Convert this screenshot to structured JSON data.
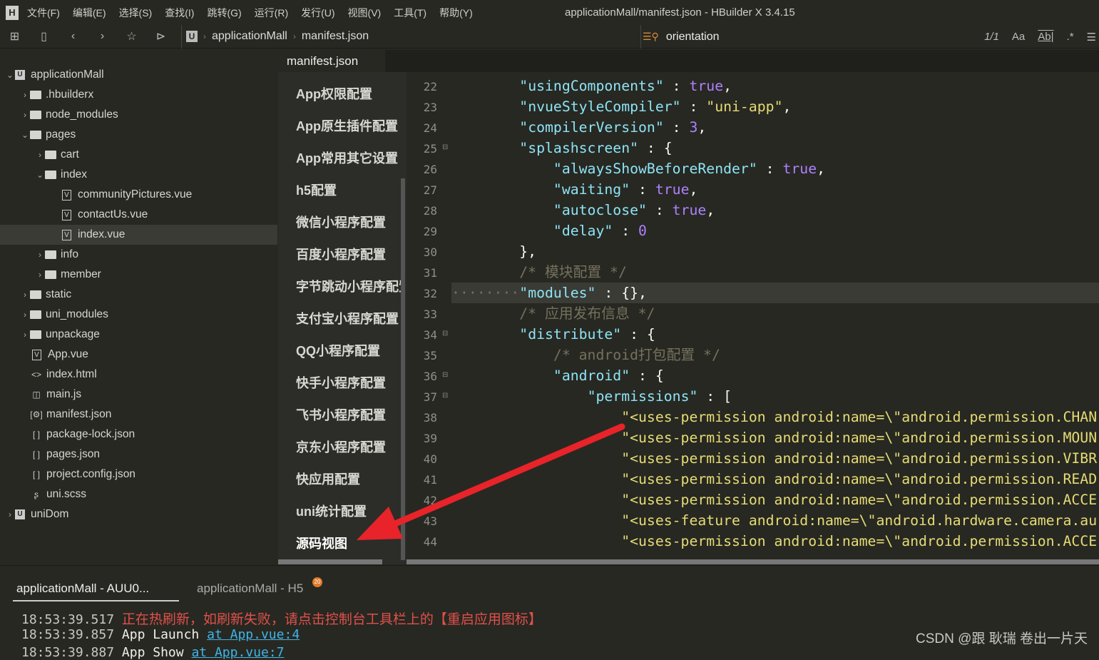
{
  "window": {
    "title": "applicationMall/manifest.json - HBuilder X 3.4.15",
    "logo": "H"
  },
  "menu": [
    "文件(F)",
    "编辑(E)",
    "选择(S)",
    "查找(I)",
    "跳转(G)",
    "运行(R)",
    "发行(U)",
    "视图(V)",
    "工具(T)",
    "帮助(Y)"
  ],
  "toolbar": {
    "icons": [
      "new-file-icon",
      "save-icon",
      "back-icon",
      "forward-icon",
      "star-icon",
      "run-icon"
    ],
    "breadcrumb": [
      "applicationMall",
      "manifest.json"
    ],
    "project_badge": "U"
  },
  "find": {
    "value": "orientation",
    "count": "1/1",
    "case": "Aa",
    "word": "Ab|",
    "regex": ".*"
  },
  "tree": [
    {
      "label": "applicationMall",
      "depth": 0,
      "type": "project",
      "open": true
    },
    {
      "label": ".hbuilderx",
      "depth": 1,
      "type": "folder",
      "open": false
    },
    {
      "label": "node_modules",
      "depth": 1,
      "type": "folder",
      "open": false
    },
    {
      "label": "pages",
      "depth": 1,
      "type": "folder",
      "open": true
    },
    {
      "label": "cart",
      "depth": 2,
      "type": "folder",
      "open": false
    },
    {
      "label": "index",
      "depth": 2,
      "type": "folder",
      "open": true
    },
    {
      "label": "communityPictures.vue",
      "depth": 3,
      "type": "vue"
    },
    {
      "label": "contactUs.vue",
      "depth": 3,
      "type": "vue"
    },
    {
      "label": "index.vue",
      "depth": 3,
      "type": "vue",
      "selected": true
    },
    {
      "label": "info",
      "depth": 2,
      "type": "folder",
      "open": false
    },
    {
      "label": "member",
      "depth": 2,
      "type": "folder",
      "open": false
    },
    {
      "label": "static",
      "depth": 1,
      "type": "folder",
      "open": false
    },
    {
      "label": "uni_modules",
      "depth": 1,
      "type": "folder",
      "open": false
    },
    {
      "label": "unpackage",
      "depth": 1,
      "type": "folder",
      "open": false
    },
    {
      "label": "App.vue",
      "depth": 1,
      "type": "vue"
    },
    {
      "label": "index.html",
      "depth": 1,
      "type": "html"
    },
    {
      "label": "main.js",
      "depth": 1,
      "type": "js"
    },
    {
      "label": "manifest.json",
      "depth": 1,
      "type": "manifest"
    },
    {
      "label": "package-lock.json",
      "depth": 1,
      "type": "json"
    },
    {
      "label": "pages.json",
      "depth": 1,
      "type": "json"
    },
    {
      "label": "project.config.json",
      "depth": 1,
      "type": "json"
    },
    {
      "label": "uni.scss",
      "depth": 1,
      "type": "scss"
    },
    {
      "label": "uniDom",
      "depth": 0,
      "type": "project",
      "open": false
    }
  ],
  "editor_tab": "manifest.json",
  "settings": [
    "App权限配置",
    "App原生插件配置",
    "App常用其它设置",
    "h5配置",
    "微信小程序配置",
    "百度小程序配置",
    "字节跳动小程序配置",
    "支付宝小程序配置",
    "QQ小程序配置",
    "快手小程序配置",
    "飞书小程序配置",
    "京东小程序配置",
    "快应用配置",
    "uni统计配置",
    "源码视图"
  ],
  "code": [
    {
      "n": "22",
      "t": [
        [
          "p",
          "        "
        ],
        [
          "key",
          "\"usingComponents\""
        ],
        [
          "p",
          " : "
        ],
        [
          "num",
          "true"
        ],
        [
          "p",
          ","
        ]
      ]
    },
    {
      "n": "23",
      "t": [
        [
          "p",
          "        "
        ],
        [
          "key",
          "\"nvueStyleCompiler\""
        ],
        [
          "p",
          " : "
        ],
        [
          "str",
          "\"uni-app\""
        ],
        [
          "p",
          ","
        ]
      ]
    },
    {
      "n": "24",
      "t": [
        [
          "p",
          "        "
        ],
        [
          "key",
          "\"compilerVersion\""
        ],
        [
          "p",
          " : "
        ],
        [
          "num",
          "3"
        ],
        [
          "p",
          ","
        ]
      ]
    },
    {
      "n": "25",
      "fold": true,
      "t": [
        [
          "p",
          "        "
        ],
        [
          "key",
          "\"splashscreen\""
        ],
        [
          "p",
          " : {"
        ]
      ]
    },
    {
      "n": "26",
      "t": [
        [
          "p",
          "            "
        ],
        [
          "key",
          "\"alwaysShowBeforeRender\""
        ],
        [
          "p",
          " : "
        ],
        [
          "num",
          "true"
        ],
        [
          "p",
          ","
        ]
      ]
    },
    {
      "n": "27",
      "t": [
        [
          "p",
          "            "
        ],
        [
          "key",
          "\"waiting\""
        ],
        [
          "p",
          " : "
        ],
        [
          "num",
          "true"
        ],
        [
          "p",
          ","
        ]
      ]
    },
    {
      "n": "28",
      "t": [
        [
          "p",
          "            "
        ],
        [
          "key",
          "\"autoclose\""
        ],
        [
          "p",
          " : "
        ],
        [
          "num",
          "true"
        ],
        [
          "p",
          ","
        ]
      ]
    },
    {
      "n": "29",
      "t": [
        [
          "p",
          "            "
        ],
        [
          "key",
          "\"delay\""
        ],
        [
          "p",
          " : "
        ],
        [
          "num",
          "0"
        ]
      ]
    },
    {
      "n": "30",
      "t": [
        [
          "p",
          "        },"
        ]
      ]
    },
    {
      "n": "31",
      "t": [
        [
          "c",
          "        /* 模块配置 */"
        ]
      ]
    },
    {
      "n": "32",
      "hl": true,
      "t": [
        [
          "c",
          "········"
        ],
        [
          "key",
          "\"modules\""
        ],
        [
          "p",
          " : {},"
        ]
      ]
    },
    {
      "n": "33",
      "t": [
        [
          "c",
          "        /* 应用发布信息 */"
        ]
      ]
    },
    {
      "n": "34",
      "fold": true,
      "t": [
        [
          "p",
          "        "
        ],
        [
          "key",
          "\"distribute\""
        ],
        [
          "p",
          " : {"
        ]
      ]
    },
    {
      "n": "35",
      "t": [
        [
          "c",
          "            /* android打包配置 */"
        ]
      ]
    },
    {
      "n": "36",
      "fold": true,
      "t": [
        [
          "p",
          "            "
        ],
        [
          "key",
          "\"android\""
        ],
        [
          "p",
          " : {"
        ]
      ]
    },
    {
      "n": "37",
      "fold": true,
      "t": [
        [
          "p",
          "                "
        ],
        [
          "key",
          "\"permissions\""
        ],
        [
          "p",
          " : ["
        ]
      ]
    },
    {
      "n": "38",
      "t": [
        [
          "p",
          "                    "
        ],
        [
          "str",
          "\"<uses-permission android:name=\\\"android.permission.CHAN"
        ]
      ]
    },
    {
      "n": "39",
      "t": [
        [
          "p",
          "                    "
        ],
        [
          "str",
          "\"<uses-permission android:name=\\\"android.permission.MOUN"
        ]
      ]
    },
    {
      "n": "40",
      "t": [
        [
          "p",
          "                    "
        ],
        [
          "str",
          "\"<uses-permission android:name=\\\"android.permission.VIBR"
        ]
      ]
    },
    {
      "n": "41",
      "t": [
        [
          "p",
          "                    "
        ],
        [
          "str",
          "\"<uses-permission android:name=\\\"android.permission.READ"
        ]
      ]
    },
    {
      "n": "42",
      "t": [
        [
          "p",
          "                    "
        ],
        [
          "str",
          "\"<uses-permission android:name=\\\"android.permission.ACCE"
        ]
      ]
    },
    {
      "n": "43",
      "t": [
        [
          "p",
          "                    "
        ],
        [
          "str",
          "\"<uses-feature android:name=\\\"android.hardware.camera.au"
        ]
      ]
    },
    {
      "n": "44",
      "t": [
        [
          "p",
          "                    "
        ],
        [
          "str",
          "\"<uses-permission android:name=\\\"android.permission.ACCE"
        ]
      ]
    }
  ],
  "console": {
    "tabs": [
      {
        "label": "applicationMall - AUU0...",
        "active": true
      },
      {
        "label": "applicationMall - H5",
        "badge": "20"
      }
    ],
    "logs": [
      {
        "time": "18:53:39.517",
        "msg": "正在热刷新，如刷新失败，请点击控制台工具栏上的【重启应用图标】",
        "kind": "red"
      },
      {
        "time": "18:53:39.857",
        "msg": "App Launch",
        "link": "at App.vue:4"
      },
      {
        "time": "18:53:39.887",
        "msg": "App Show",
        "link": "at App.vue:7"
      }
    ]
  },
  "watermark": "CSDN @跟 耿瑞 卷出一片天",
  "colors": {
    "background": "#272822",
    "key": "#8ee3f5",
    "string": "#e6db74",
    "constant": "#ae81ff",
    "comment": "#75715e",
    "annotation_arrow": "#e8232a"
  }
}
